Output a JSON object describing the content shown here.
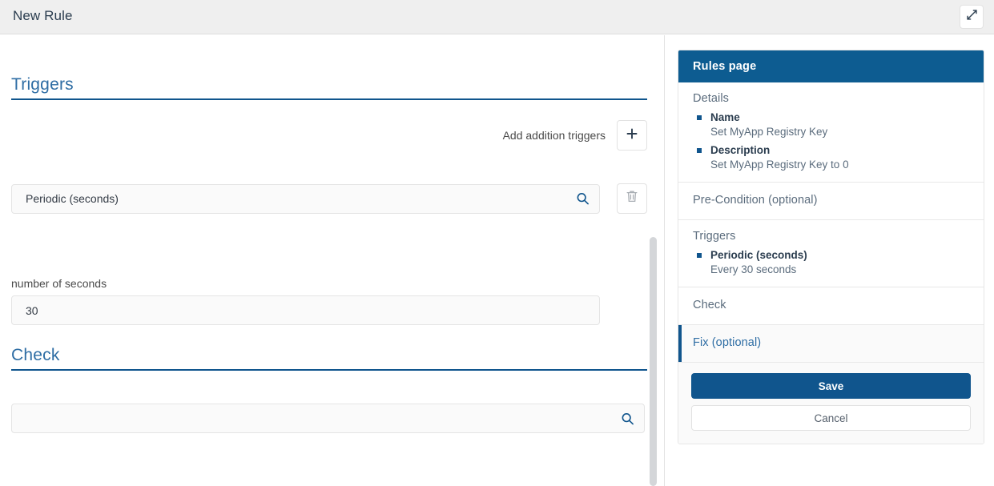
{
  "window": {
    "title": "New Rule",
    "expand_icon": "expand-diagonal-icon"
  },
  "form": {
    "triggers": {
      "heading": "Triggers",
      "add_label": "Add addition triggers",
      "add_icon": "plus-icon",
      "delete_icon": "trash-icon",
      "search_icon": "search-icon",
      "trigger_value": "Periodic (seconds)",
      "seconds_label": "number of seconds",
      "seconds_value": "30"
    },
    "check": {
      "heading": "Check",
      "search_icon": "search-icon",
      "value": "",
      "placeholder": ""
    }
  },
  "summary": {
    "header": "Rules page",
    "sections": [
      {
        "title": "Details",
        "items": [
          {
            "key": "Name",
            "value": "Set MyApp Registry Key"
          },
          {
            "key": "Description",
            "value": "Set MyApp Registry Key to 0"
          }
        ]
      },
      {
        "title": "Pre-Condition (optional)",
        "items": []
      },
      {
        "title": "Triggers",
        "items": [
          {
            "key": "Periodic (seconds)",
            "value": "Every 30 seconds"
          }
        ]
      },
      {
        "title": "Check",
        "items": []
      },
      {
        "title": "Fix (optional)",
        "items": [],
        "active": true
      }
    ],
    "save_label": "Save",
    "cancel_label": "Cancel"
  },
  "colors": {
    "brand_blue": "#10558d",
    "header_blue": "#0d5c91",
    "heading_blue": "#2e6da4",
    "muted_text": "#5b6c7d",
    "topbar_bg": "#efefef"
  }
}
